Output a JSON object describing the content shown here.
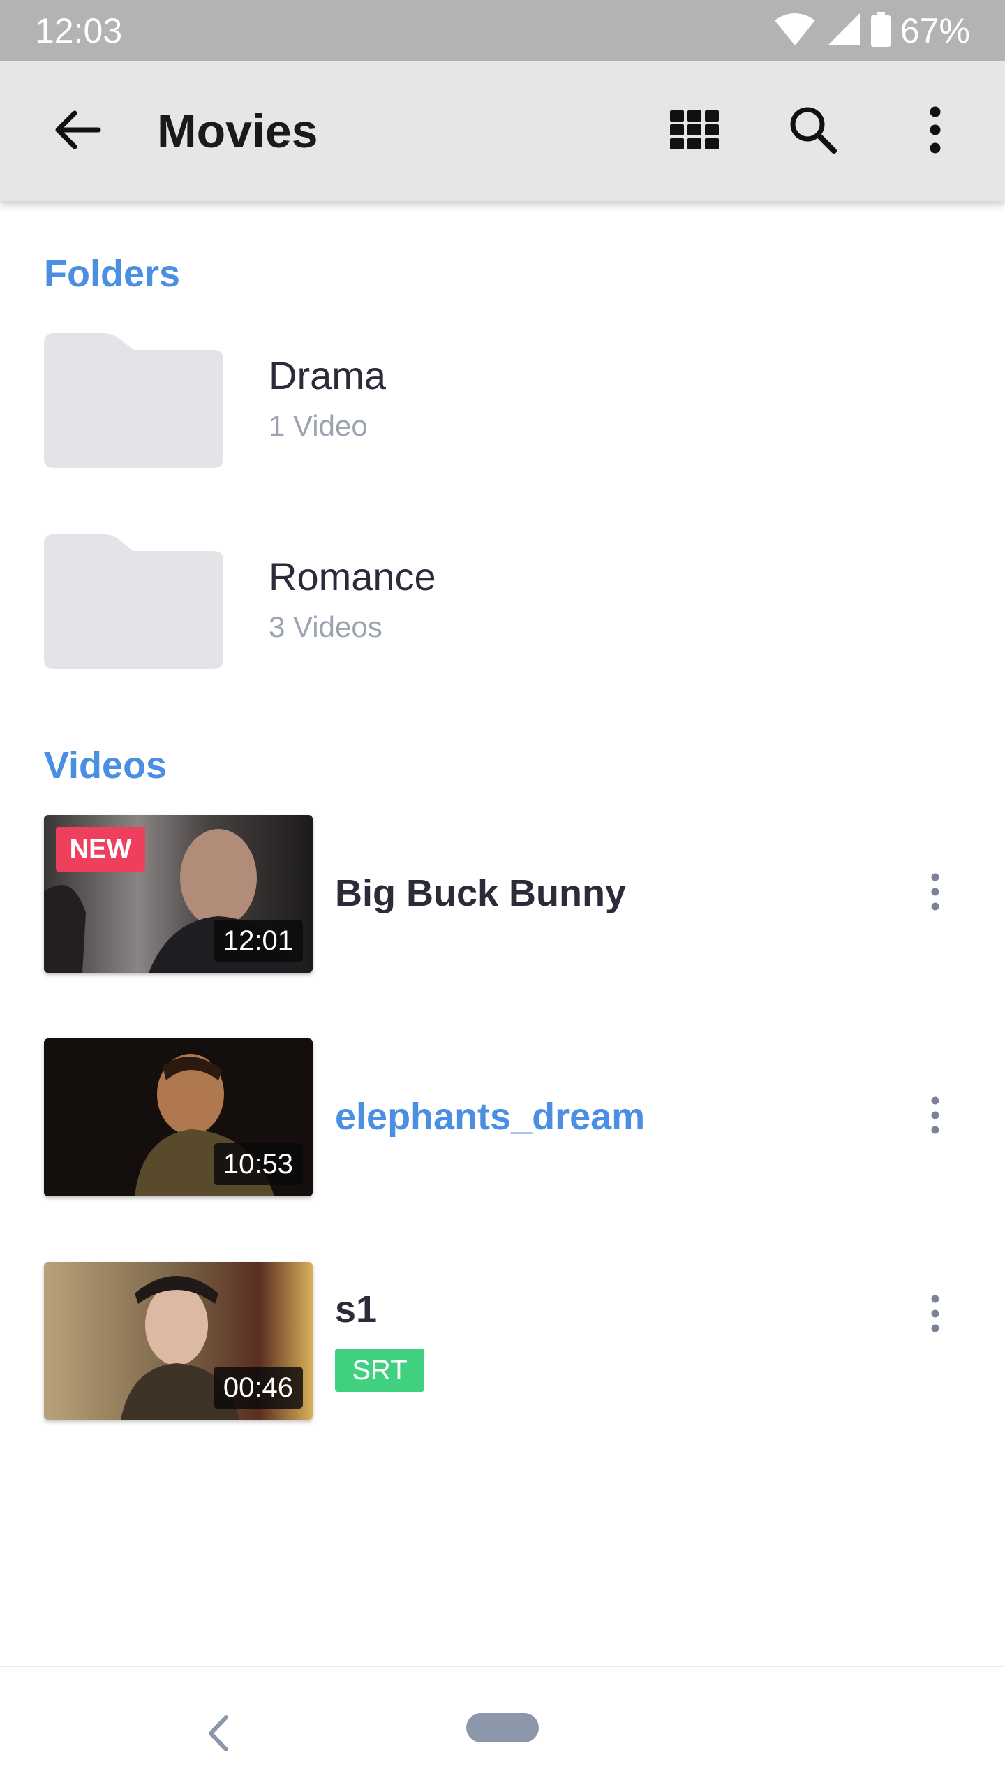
{
  "status_bar": {
    "time": "12:03",
    "battery": "67%",
    "icons": [
      "wifi-icon",
      "signal-icon",
      "battery-icon"
    ]
  },
  "app_bar": {
    "title": "Movies",
    "icons": [
      "back-arrow-icon",
      "grid-view-icon",
      "search-icon",
      "more-vert-icon"
    ]
  },
  "folders": {
    "header": "Folders",
    "items": [
      {
        "name": "Drama",
        "count": "1 Video"
      },
      {
        "name": "Romance",
        "count": "3 Videos"
      }
    ]
  },
  "videos": {
    "header": "Videos",
    "items": [
      {
        "title": "Big Buck Bunny",
        "duration": "12:01",
        "badge": "NEW"
      },
      {
        "title": "elephants_dream",
        "duration": "10:53",
        "highlighted": true
      },
      {
        "title": "s1",
        "duration": "00:46",
        "tag": "SRT"
      }
    ]
  },
  "colors": {
    "accent": "#4a8fe2",
    "new_badge": "#ee3f5c",
    "srt_badge": "#3fd17f",
    "app_bar": "#e6e6e6",
    "status_bar": "#b3b3b3"
  }
}
